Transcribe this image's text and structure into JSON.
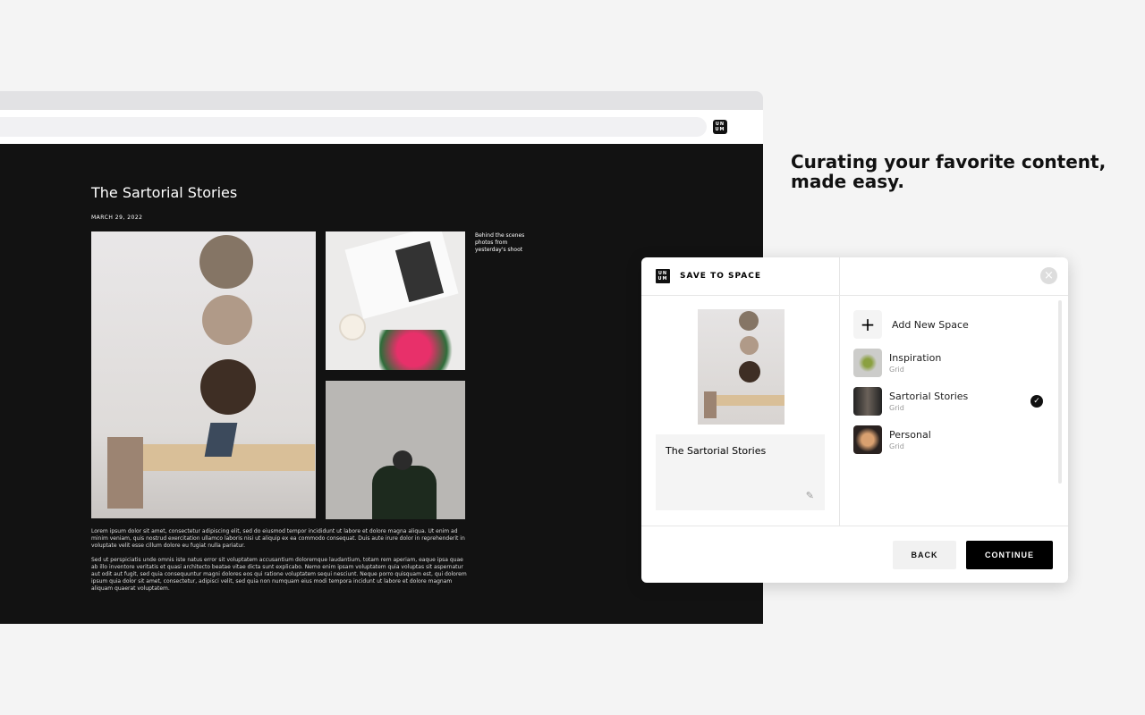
{
  "browser": {
    "logo": "UN UM"
  },
  "article": {
    "title": "The Sartorial Stories",
    "date": "MARCH 29, 2022",
    "caption": "Behind the scenes photos from yesterday's shoot",
    "paragraphs": [
      "Lorem ipsum dolor sit amet, consectetur adipiscing elit, sed do eiusmod tempor incididunt ut labore et dolore magna aliqua. Ut enim ad minim veniam, quis nostrud exercitation ullamco laboris nisi ut aliquip ex ea commodo consequat. Duis aute irure dolor in reprehenderit in voluptate velit esse cillum dolore eu fugiat nulla pariatur.",
      "Sed ut perspiciatis unde omnis iste natus error sit voluptatem accusantium doloremque laudantium, totam rem aperiam, eaque ipsa quae ab illo inventore veritatis et quasi architecto beatae vitae dicta sunt explicabo. Nemo enim ipsam voluptatem quia voluptas sit aspernatur aut odit aut fugit, sed quia consequuntur magni dolores eos qui ratione voluptatem sequi nesciunt. Neque porro quisquam est, qui dolorem ipsum quia dolor sit amet, consectetur, adipisci velit, sed quia non numquam eius modi tempora incidunt ut labore et dolore magnam aliquam quaerat voluptatem."
    ]
  },
  "tagline": "Curating your favorite content, made easy.",
  "modal": {
    "title": "SAVE TO SPACE",
    "note": "The Sartorial Stories",
    "add_label": "Add New Space",
    "spaces": [
      {
        "name": "Inspiration",
        "type": "Grid",
        "selected": false
      },
      {
        "name": "Sartorial Stories",
        "type": "Grid",
        "selected": true
      },
      {
        "name": "Personal",
        "type": "Grid",
        "selected": false
      }
    ],
    "back": "BACK",
    "continue": "CONTINUE"
  }
}
